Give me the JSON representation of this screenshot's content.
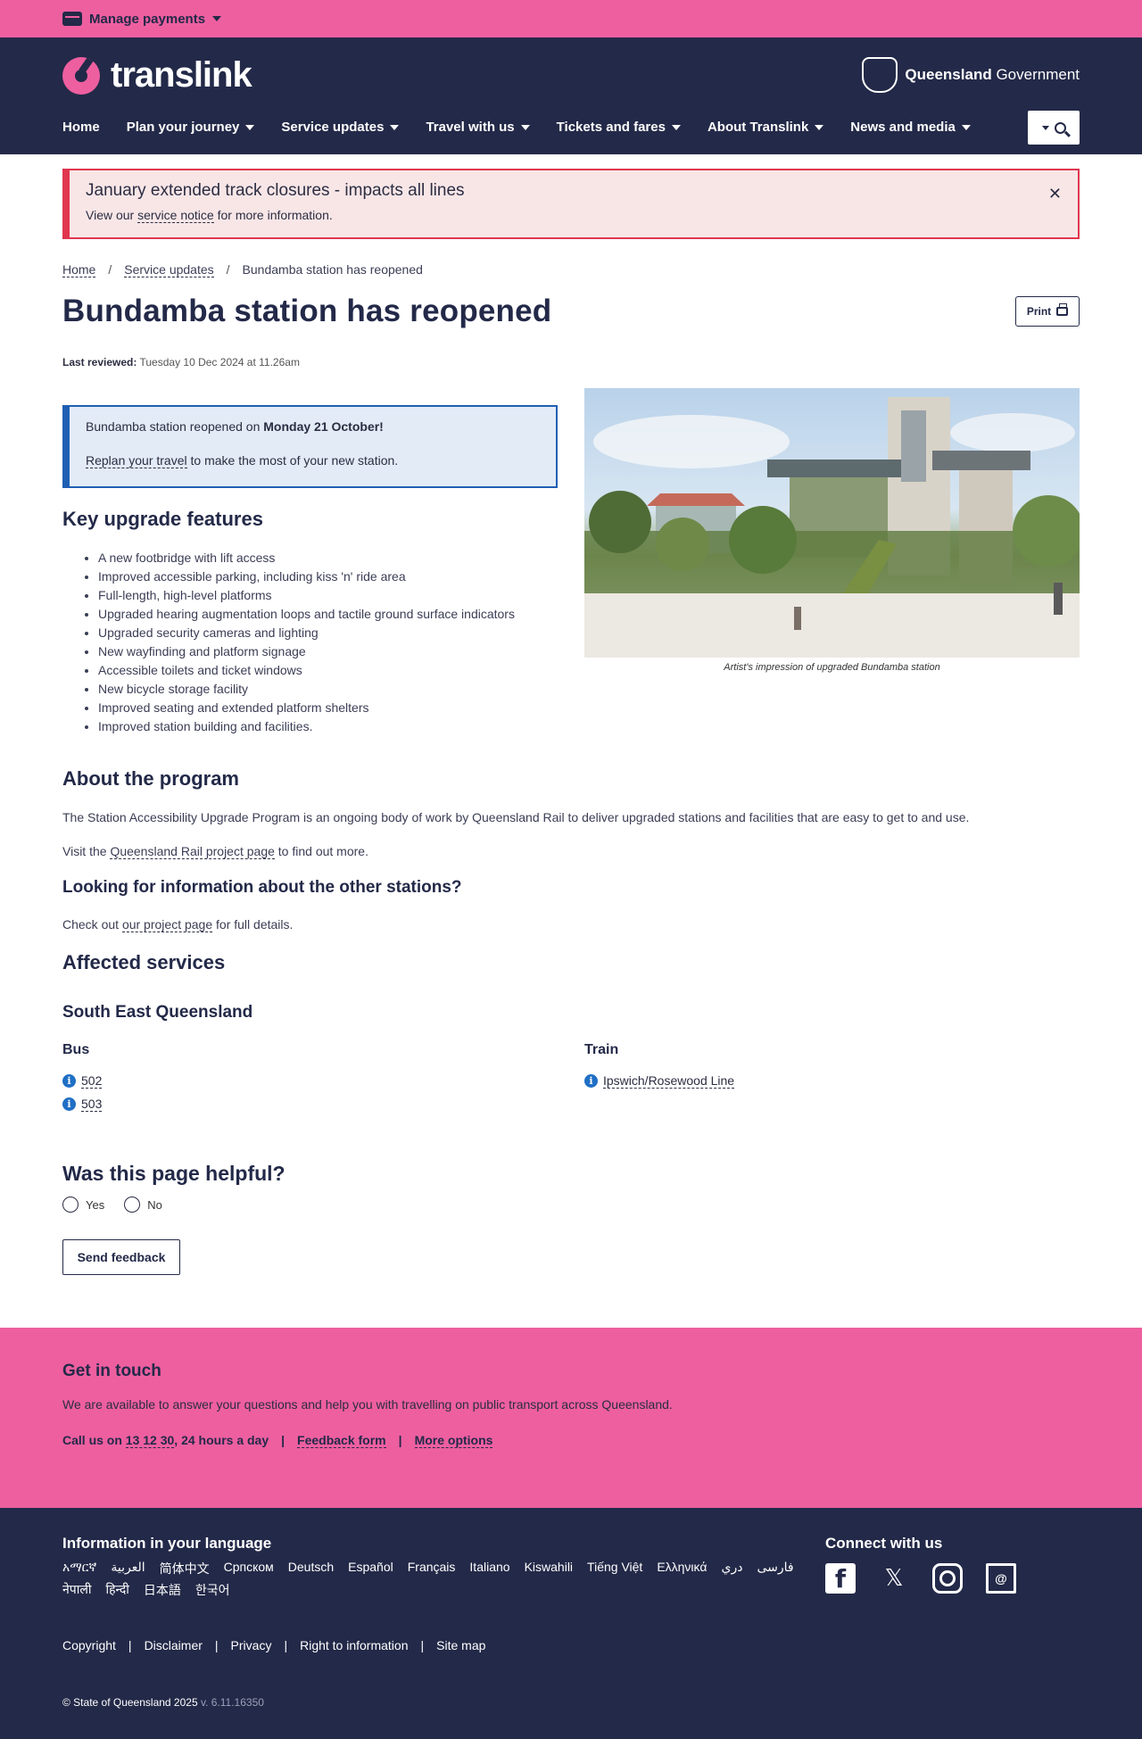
{
  "topbar": {
    "manage_payments": "Manage payments"
  },
  "header": {
    "logo_text": "translink",
    "gov_bold": "Queensland",
    "gov_rest": "Government",
    "nav": [
      {
        "label": "Home"
      },
      {
        "label": "Plan your journey"
      },
      {
        "label": "Service updates"
      },
      {
        "label": "Travel with us"
      },
      {
        "label": "Tickets and fares"
      },
      {
        "label": "About Translink"
      },
      {
        "label": "News and media"
      }
    ]
  },
  "alert": {
    "title": "January extended track closures - impacts all lines",
    "body_prefix": "View our",
    "body_link": "service notice",
    "body_suffix": "for more information."
  },
  "breadcrumb": [
    "Home",
    "Service updates",
    "Bundamba station has reopened"
  ],
  "page": {
    "title": "Bundamba station has reopened",
    "print_label": "Print",
    "reviewed_label": "Last reviewed:",
    "reviewed_value": "Tuesday 10 Dec 2024 at 11.26am"
  },
  "info_box": {
    "line1_prefix": "Bundamba station reopened on",
    "line1_bold": "Monday 21 October!",
    "line2_link": "Replan your travel",
    "line2_suffix": "to make the most of your new station."
  },
  "features": {
    "title": "Key upgrade features",
    "items": [
      "A new footbridge with lift access",
      "Improved accessible parking, including kiss 'n' ride area",
      "Full-length, high-level platforms",
      "Upgraded hearing augmentation loops and tactile ground surface indicators",
      "Upgraded security cameras and lighting",
      "New wayfinding and platform signage",
      "Accessible toilets and ticket windows",
      "New bicycle storage facility",
      "Improved seating and extended platform shelters",
      "Improved station building and facilities."
    ]
  },
  "image": {
    "caption": "Artist's impression of upgraded Bundamba station"
  },
  "about": {
    "title": "About the program",
    "p1": "The Station Accessibility Upgrade Program is an ongoing body of work by Queensland Rail to deliver upgraded stations and facilities that are easy to get to and use.",
    "p2_prefix": "Visit the",
    "p2_link": "Queensland Rail project page",
    "p2_suffix": "to find out more."
  },
  "looking": {
    "title": "Looking for information about the other stations?",
    "prefix": "Check out",
    "link": "our project page",
    "suffix": "for full details."
  },
  "affected": {
    "title": "Affected services",
    "region": "South East Queensland",
    "bus_title": "Bus",
    "bus": [
      "502",
      "503"
    ],
    "train_title": "Train",
    "train": [
      "Ipswich/Rosewood Line"
    ]
  },
  "feedback": {
    "title": "Was this page helpful?",
    "yes": "Yes",
    "no": "No",
    "send": "Send feedback"
  },
  "touch": {
    "title": "Get in touch",
    "desc": "We are available to answer your questions and help you with travelling on public transport across Queensland.",
    "call_prefix": "Call us on",
    "call_number": "13 12 30",
    "call_suffix": ", 24 hours a day",
    "feedback_form": "Feedback form",
    "more_options": "More options",
    "sep": "|"
  },
  "footer": {
    "lang_title": "Information in your language",
    "languages": [
      "አማርኛ",
      "العربية",
      "简体中文",
      "Српском",
      "Deutsch",
      "Español",
      "Français",
      "Italiano",
      "Kiswahili",
      "Tiếng Việt",
      "Ελληνικά",
      "دري",
      "فارسی",
      "नेपाली",
      "हिन्दी",
      "日本語",
      "한국어"
    ],
    "connect_title": "Connect with us",
    "legal": [
      "Copyright",
      "Disclaimer",
      "Privacy",
      "Right to information",
      "Site map"
    ],
    "copyright": "© State of Queensland 2025",
    "version": "v. 6.11.16350"
  }
}
